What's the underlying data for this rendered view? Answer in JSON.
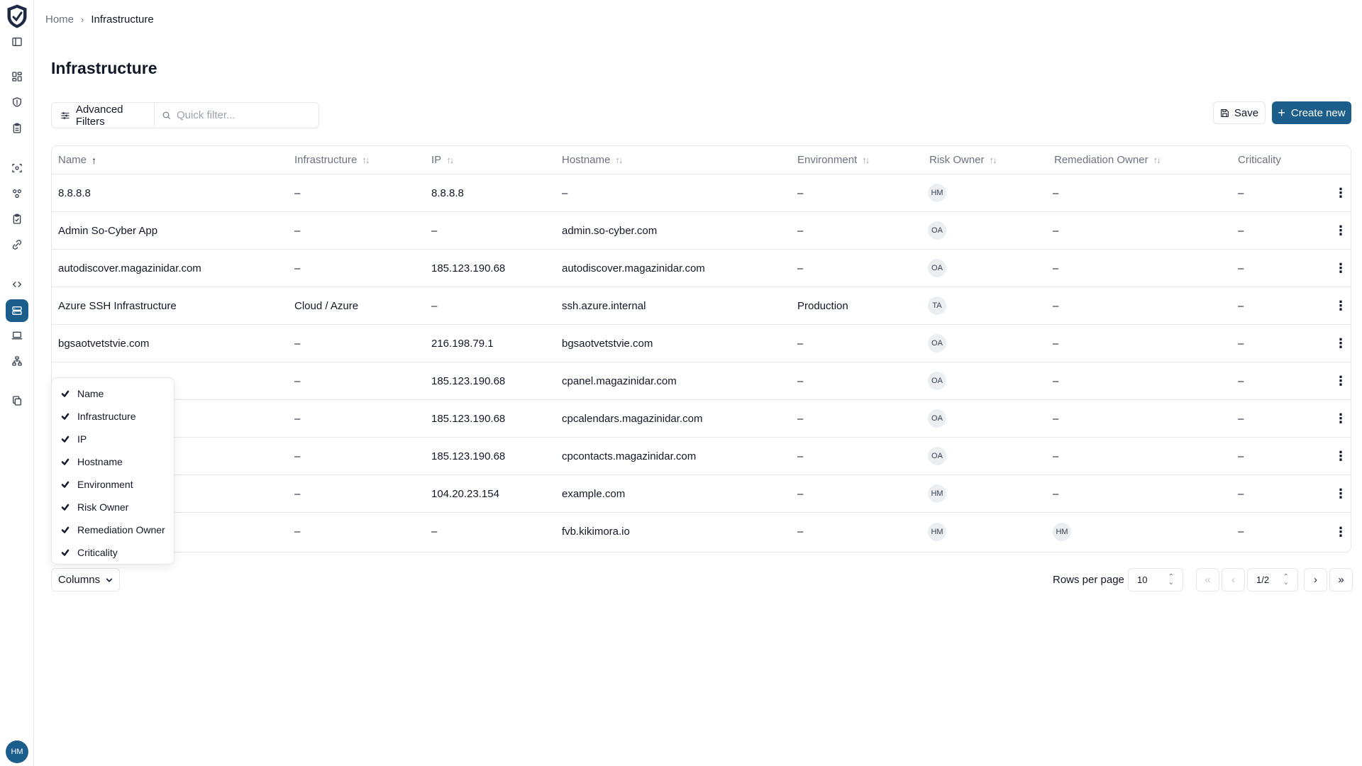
{
  "breadcrumb": {
    "home": "Home",
    "current": "Infrastructure"
  },
  "page": {
    "title": "Infrastructure"
  },
  "toolbar": {
    "advanced_filters_label": "Advanced Filters",
    "quick_filter_placeholder": "Quick filter...",
    "quick_filter_value": "",
    "save_label": "Save",
    "create_label": "Create new"
  },
  "table": {
    "headers": [
      "Name",
      "Infrastructure",
      "IP",
      "Hostname",
      "Environment",
      "Risk Owner",
      "Remediation Owner",
      "Criticality"
    ],
    "sorted_column": "Name",
    "sort_direction": "ascending",
    "rows": [
      {
        "name": "8.8.8.8",
        "infrastructure": "–",
        "ip": "8.8.8.8",
        "hostname": "–",
        "environment": "–",
        "risk_owner": "HM",
        "remediation_owner": "–",
        "criticality": "–"
      },
      {
        "name": "Admin So-Cyber App",
        "infrastructure": "–",
        "ip": "–",
        "hostname": "admin.so-cyber.com",
        "environment": "–",
        "risk_owner": "OA",
        "remediation_owner": "–",
        "criticality": "–"
      },
      {
        "name": "autodiscover.magazinidar.com",
        "infrastructure": "–",
        "ip": "185.123.190.68",
        "hostname": "autodiscover.magazinidar.com",
        "environment": "–",
        "risk_owner": "OA",
        "remediation_owner": "–",
        "criticality": "–"
      },
      {
        "name": "Azure SSH Infrastructure",
        "infrastructure": "Cloud / Azure",
        "ip": "–",
        "hostname": "ssh.azure.internal",
        "environment": "Production",
        "risk_owner": "TA",
        "remediation_owner": "–",
        "criticality": "–"
      },
      {
        "name": "bgsaotvetstvie.com",
        "infrastructure": "–",
        "ip": "216.198.79.1",
        "hostname": "bgsaotvetstvie.com",
        "environment": "–",
        "risk_owner": "OA",
        "remediation_owner": "–",
        "criticality": "–"
      },
      {
        "name": "",
        "infrastructure": "–",
        "ip": "185.123.190.68",
        "hostname": "cpanel.magazinidar.com",
        "environment": "–",
        "risk_owner": "OA",
        "remediation_owner": "–",
        "criticality": "–"
      },
      {
        "name": "om",
        "infrastructure": "–",
        "ip": "185.123.190.68",
        "hostname": "cpcalendars.magazinidar.com",
        "environment": "–",
        "risk_owner": "OA",
        "remediation_owner": "–",
        "criticality": "–"
      },
      {
        "name": "m",
        "infrastructure": "–",
        "ip": "185.123.190.68",
        "hostname": "cpcontacts.magazinidar.com",
        "environment": "–",
        "risk_owner": "OA",
        "remediation_owner": "–",
        "criticality": "–"
      },
      {
        "name": "",
        "infrastructure": "–",
        "ip": "104.20.23.154",
        "hostname": "example.com",
        "environment": "–",
        "risk_owner": "HM",
        "remediation_owner": "–",
        "criticality": "–"
      },
      {
        "name": "",
        "infrastructure": "–",
        "ip": "–",
        "hostname": "fvb.kikimora.io",
        "environment": "–",
        "risk_owner": "HM",
        "remediation_owner": "HM",
        "criticality": "–"
      }
    ]
  },
  "column_menu": {
    "items": [
      "Name",
      "Infrastructure",
      "IP",
      "Hostname",
      "Environment",
      "Risk Owner",
      "Remediation Owner",
      "Criticality"
    ]
  },
  "columns_button_label": "Columns",
  "pagination": {
    "rows_per_page_label": "Rows per page",
    "rows_per_page": "10",
    "page": "1/2",
    "first": "«",
    "prev": "‹",
    "next": "›",
    "last": "»"
  },
  "user": {
    "initials": "HM"
  },
  "colors": {
    "accent": "#1b5e8c",
    "border": "#e5e7eb",
    "muted": "#6b7280"
  },
  "sidebar": {
    "icons": [
      "layout-toggle-icon",
      "dashboard-icon",
      "shield-icon",
      "clipboard-icon",
      "scan-icon",
      "groups-icon",
      "checklist-icon",
      "integrations-icon",
      "code-icon",
      "infrastructure-icon",
      "laptop-icon",
      "hierarchy-icon",
      "copy-icon"
    ]
  }
}
